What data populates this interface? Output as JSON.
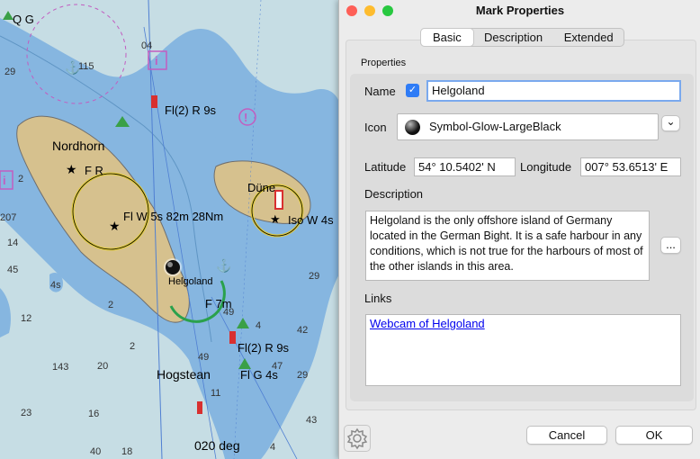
{
  "chart": {
    "labels": {
      "qg": "Q G",
      "nordhorn": "Nordhorn",
      "fr": "F R",
      "fl2r9s_top": "Fl(2) R 9s",
      "flw5s": "Fl W 5s 82m 28Nm",
      "duene": "Düne",
      "isow4s": "Iso W 4s",
      "helgoland": "Helgoland",
      "f7m": "F 7m",
      "fl2r9s_bottom": "Fl(2) R 9s",
      "hogstean": "Hogstean",
      "flg4s": "Fl G 4s",
      "heading": "020 deg"
    },
    "depths": [
      "04",
      "115",
      "29",
      "2",
      "207",
      "14",
      "45",
      "4s",
      "12",
      "2",
      "143",
      "20",
      "23",
      "16",
      "2",
      "11",
      "47",
      "29",
      "42",
      "4",
      "18",
      "49",
      "43",
      "4",
      "40",
      "49",
      "29"
    ]
  },
  "dialog": {
    "title": "Mark Properties",
    "tabs": [
      {
        "label": "Basic",
        "selected": true
      },
      {
        "label": "Description",
        "selected": false
      },
      {
        "label": "Extended",
        "selected": false
      }
    ],
    "properties_label": "Properties",
    "name_label": "Name",
    "name_value": "Helgoland",
    "show_name_checked": true,
    "icon_label": "Icon",
    "icon_value": "Symbol-Glow-LargeBlack",
    "icon_dropdown": "⌄",
    "latitude_label": "Latitude",
    "latitude_value": "54° 10.5402' N",
    "longitude_label": "Longitude",
    "longitude_value": "007° 53.6513' E",
    "description_label": "Description",
    "description_value": "Helgoland is the only offshore island of Germany located in the German Bight. It is a safe harbour in any conditions, which is not true for the harbours of most of the other islands in this area.",
    "description_more": "...",
    "links_label": "Links",
    "link_text": "Webcam of Helgoland",
    "cancel_label": "Cancel",
    "ok_label": "OK",
    "colors": {
      "accent": "#2f7cf6",
      "traffic_close": "#fe5f57",
      "traffic_min": "#febc2e",
      "traffic_max": "#28c840",
      "water_deep": "#c6dde4",
      "water_shallow": "#7ab0dd",
      "land": "#d6c18e",
      "link": "#0000ee"
    }
  }
}
